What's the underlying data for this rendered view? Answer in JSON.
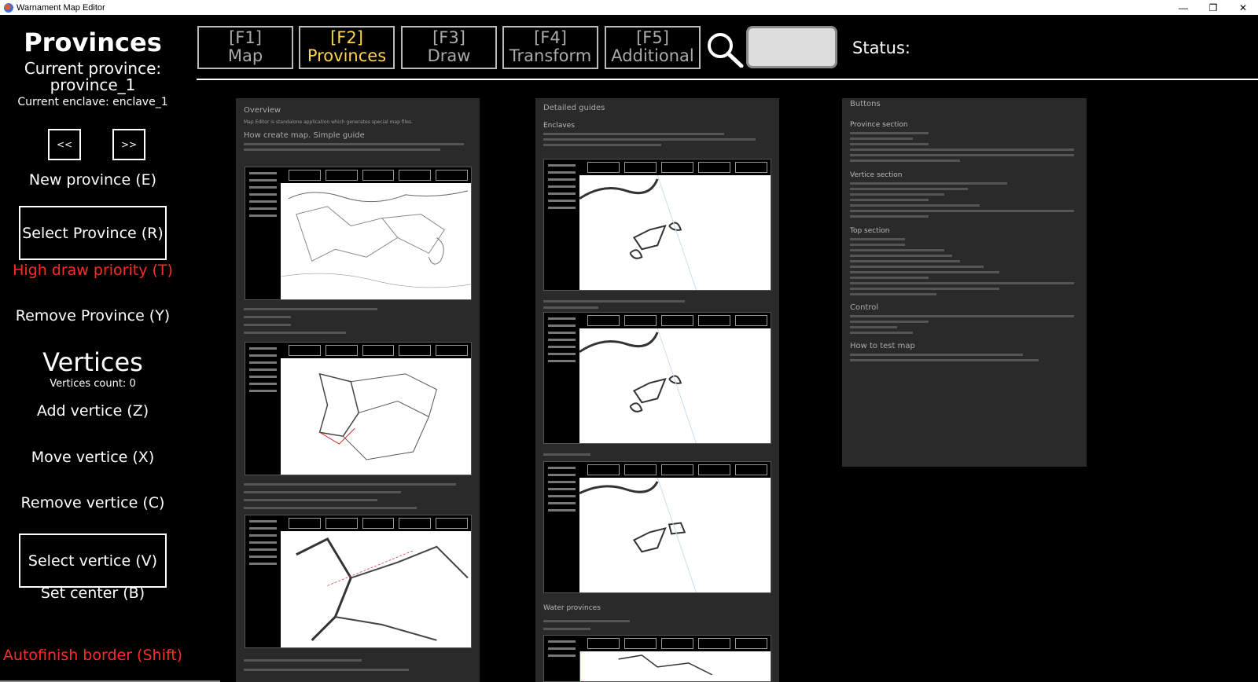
{
  "window": {
    "title": "Warnament Map Editor",
    "controls": [
      "—",
      "❐",
      "✕"
    ]
  },
  "sidebar": {
    "section_title": "Provinces",
    "current_province_label": "Current province:",
    "current_province_value": "province_1",
    "current_enclave": "Current enclave: enclave_1",
    "prev_enclave": "<<",
    "next_enclave": ">>",
    "new_province": "New province (E)",
    "select_province": "Select Province (R)",
    "high_draw_priority": "High draw priority (T)",
    "remove_province": "Remove Province (Y)",
    "vertices_title": "Vertices",
    "vertices_count": "Vertices count: 0",
    "add_vertice": "Add vertice (Z)",
    "move_vertice": "Move vertice (X)",
    "remove_vertice": "Remove vertice (C)",
    "select_vertice": "Select vertice (V)",
    "set_center": "Set center (B)",
    "autofinish_border": "Autofinish border (Shift)"
  },
  "toolbar": {
    "tabs": [
      {
        "key": "[F1]",
        "label": "Map",
        "active": false
      },
      {
        "key": "[F2]",
        "label": "Provinces",
        "active": true
      },
      {
        "key": "[F3]",
        "label": "Draw",
        "active": false
      },
      {
        "key": "[F4]",
        "label": "Transform",
        "active": false
      },
      {
        "key": "[F5]",
        "label": "Additional",
        "active": false
      }
    ],
    "search_value": "",
    "status_label": "Status:"
  },
  "colors": {
    "background": "#000000",
    "active_tab": "#ffd54a",
    "warning_red": "#ff2b2b",
    "panel": "#2a2a2a"
  },
  "guides": {
    "overview": {
      "heading": "Overview",
      "intro": "Map Editor is standalone application which generates special map files.",
      "subheading": "How create map. Simple guide"
    },
    "detailed": {
      "heading": "Detailed guides",
      "subheading": "Enclaves",
      "water_heading": "Water provinces"
    },
    "buttons": {
      "heading": "Buttons",
      "province_section": "Province section",
      "vertice_section": "Vertice section",
      "top_section": "Top section",
      "control": "Control",
      "how_to_test": "How to test map"
    }
  }
}
